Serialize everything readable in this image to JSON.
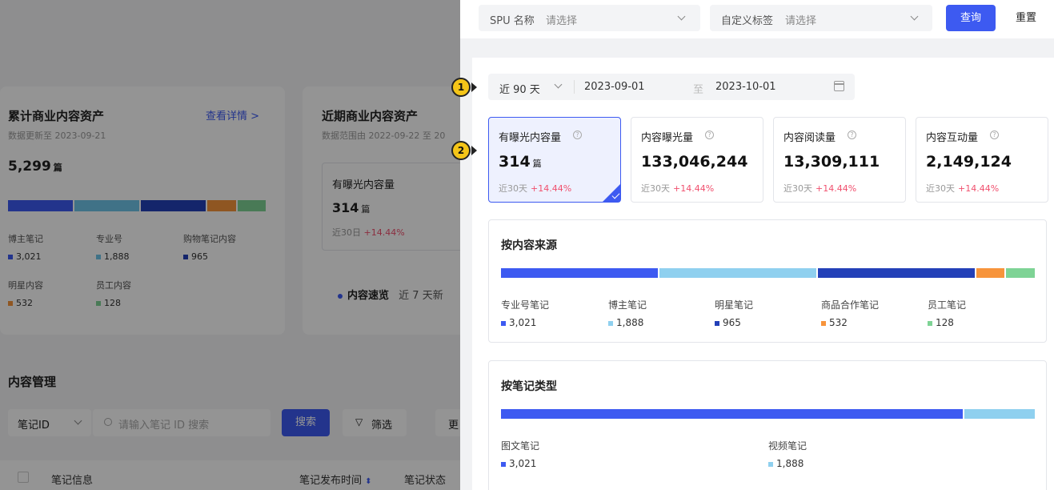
{
  "background": {
    "cumulative": {
      "title": "累计商业内容资产",
      "link": "查看详情 >",
      "updated": "数据更新至 2023-09-21",
      "total": "5,299",
      "total_unit": "篇",
      "legend": [
        {
          "label": "博主笔记",
          "value": "3,021",
          "color": "#3d5af1"
        },
        {
          "label": "专业号",
          "value": "1,888",
          "color": "#6fc5e8"
        },
        {
          "label": "购物笔记内容",
          "value": "965",
          "color": "#2340b8"
        },
        {
          "label": "明星内容",
          "value": "532",
          "color": "#f7943b"
        },
        {
          "label": "员工内容",
          "value": "128",
          "color": "#7ed395"
        }
      ]
    },
    "recent": {
      "title": "近期商业内容资产",
      "range": "数据范围由 2022-09-22 至 20",
      "kpi_label": "有曝光内容量",
      "kpi_value": "314",
      "kpi_unit": "篇",
      "kpi_sub": "近30日",
      "kpi_pct": "+14.44%",
      "quick_label": "内容速览",
      "quick_text": "近 7 天新"
    },
    "manage": {
      "title": "内容管理",
      "select_value": "笔记ID",
      "search_placeholder": "请输入笔记 ID 搜索",
      "search_button": "搜索",
      "filter_button": "筛选",
      "more_button": "更",
      "col_info": "笔记信息",
      "col_time": "笔记发布时间",
      "col_status": "笔记状态"
    }
  },
  "drawer": {
    "filters": {
      "spu_label": "SPU 名称",
      "spu_placeholder": "请选择",
      "tag_label": "自定义标签",
      "tag_placeholder": "请选择",
      "query_button": "查询",
      "reset_button": "重置"
    },
    "range": {
      "preset": "近 90 天",
      "start": "2023-09-01",
      "to": "至",
      "end": "2023-10-01"
    },
    "kpis": [
      {
        "label": "有曝光内容量",
        "value": "314",
        "unit": "篇",
        "sub": "近30天",
        "pct": "+14.44%",
        "active": true
      },
      {
        "label": "内容曝光量",
        "value": "133,046,244",
        "unit": "",
        "sub": "近30天",
        "pct": "+14.44%",
        "active": false
      },
      {
        "label": "内容阅读量",
        "value": "13,309,111",
        "unit": "",
        "sub": "近30天",
        "pct": "+14.44%",
        "active": false
      },
      {
        "label": "内容互动量",
        "value": "2,149,124",
        "unit": "",
        "sub": "近30天",
        "pct": "+14.44%",
        "active": false
      }
    ],
    "by_source": {
      "title": "按内容来源",
      "items": [
        {
          "label": "专业号笔记",
          "value": "3,021",
          "color": "#3d5af1"
        },
        {
          "label": "博主笔记",
          "value": "1,888",
          "color": "#8fd0ef"
        },
        {
          "label": "明星笔记",
          "value": "965",
          "color": "#2340b8"
        },
        {
          "label": "商品合作笔记",
          "value": "532",
          "color": "#f7943b"
        },
        {
          "label": "员工笔记",
          "value": "128",
          "color": "#7ed395"
        }
      ]
    },
    "by_type": {
      "title": "按笔记类型",
      "items": [
        {
          "label": "图文笔记",
          "value": "3,021",
          "color": "#3d5af1"
        },
        {
          "label": "视频笔记",
          "value": "1,888",
          "color": "#8fd0ef"
        }
      ]
    },
    "badges": [
      "1",
      "2"
    ]
  }
}
